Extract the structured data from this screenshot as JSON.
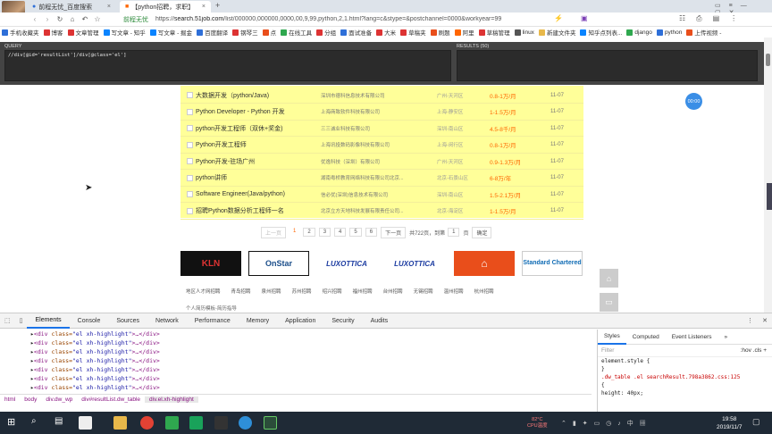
{
  "browser": {
    "tabs": [
      {
        "label": "前程无忧_百度搜索",
        "active": false
      },
      {
        "label": "【python招聘，求职】",
        "active": true
      }
    ],
    "new_tab_label": "+",
    "site_name": "前程无忧",
    "url_prefix": "https://",
    "url_domain": "search.51job.com",
    "url_rest": "/list/000000,000000,0000,00,9,99,python,2,1.html?lang=c&stype=&postchannel=0000&workyear=99",
    "bookmarks": [
      "手机收藏夹",
      "博客",
      "文章管理",
      "写文章 - 知乎",
      "写文章 - 掘金",
      "百度翻译",
      "钢琴三",
      "点",
      "在线工具",
      "分组",
      "面试准备",
      "大米",
      "草稿夹",
      "刷题",
      "阿里",
      "草稿管理",
      "linux",
      "新建文件夹",
      "知乎点列表...",
      "django",
      "python",
      "上传视频 -"
    ]
  },
  "xpath_helper": {
    "query_label": "QUERY",
    "results_label": "RESULTS (50)",
    "query": "//div[@id='resultList']/div[@class='el']"
  },
  "jobs": [
    {
      "title": "大数据开发（python/Java)",
      "company": "深圳市德科信息技术有限公司",
      "place": "广州-天河区",
      "salary": "0.8-1万/月",
      "date": "11-07"
    },
    {
      "title": "Python Developer - Python 开发",
      "company": "上海商致软件科技有限公司",
      "place": "上海-静安区",
      "salary": "1-1.5万/月",
      "date": "11-07"
    },
    {
      "title": "python开发工程师（双休+奖金)",
      "company": "三三诚业科技有限公司",
      "place": "深圳-南山区",
      "salary": "4.5-8千/月",
      "date": "11-07"
    },
    {
      "title": "Python开发工程师",
      "company": "上海讯投数码影像科技有限公司",
      "place": "上海-闵行区",
      "salary": "0.8-1万/月",
      "date": "11-07"
    },
    {
      "title": "Python开发-驻场广州",
      "company": "优逸科技（深圳）有限公司",
      "place": "广州-天河区",
      "salary": "0.9-1.3万/月",
      "date": "11-07"
    },
    {
      "title": "python讲师",
      "company": "湖南粤桥教育网络科技有限公司北京...",
      "place": "北京-石景山区",
      "salary": "6-8万/年",
      "date": "11-07"
    },
    {
      "title": "Software Engineer(Java/python)",
      "company": "信必优(深圳)信息技术有限公司",
      "place": "深圳-南山区",
      "salary": "1.5-2.1万/月",
      "date": "11-07"
    },
    {
      "title": "招聘Python数据分析工程师一名",
      "company": "北京立方天地科技发展有限责任公司...",
      "place": "北京-海淀区",
      "salary": "1-1.5万/月",
      "date": "11-07"
    }
  ],
  "pagination": {
    "prev": "上一页",
    "pages": [
      "1",
      "2",
      "3",
      "4",
      "5",
      "6"
    ],
    "next": "下一页",
    "total": "共722页，到第",
    "page_input": "1",
    "page_unit": "页",
    "confirm": "确定"
  },
  "logos": [
    "KLN",
    "OnStar",
    "LUXOTTICA",
    "LUXOTTICA",
    "",
    "Standard Chartered"
  ],
  "logo_colors": {
    "kln": "#8b1a1a",
    "onstar": "#1b4e8a",
    "luxottica": "#1a3aa0",
    "red_logo": "#e94e1b",
    "standard": "#0f6bb4"
  },
  "cities": [
    "地区人才网招聘",
    "青岛招聘",
    "泉州招聘",
    "苏州招聘",
    "绍兴招聘",
    "福州招聘",
    "台州招聘",
    "无锡招聘",
    "温州招聘",
    "杭州招聘"
  ],
  "resume_tip": "个人简历模板-简历指导",
  "timer": "00:00",
  "devtools": {
    "tabs": [
      "Elements",
      "Console",
      "Sources",
      "Network",
      "Performance",
      "Memory",
      "Application",
      "Security",
      "Audits"
    ],
    "active_tab": "Elements",
    "dom_lines": [
      {
        "tag_open": "<div ",
        "attr": "class=",
        "val": "\"el xh-highlight\"",
        "rest": ">…</div>"
      },
      {
        "tag_open": "<div ",
        "attr": "class=",
        "val": "\"el xh-highlight\"",
        "rest": ">…</div>"
      },
      {
        "tag_open": "<div ",
        "attr": "class=",
        "val": "\"el xh-highlight\"",
        "rest": ">…</div>"
      },
      {
        "tag_open": "<div ",
        "attr": "class=",
        "val": "\"el xh-highlight\"",
        "rest": ">…</div>"
      },
      {
        "tag_open": "<div ",
        "attr": "class=",
        "val": "\"el xh-highlight\"",
        "rest": ">…</div>"
      },
      {
        "tag_open": "<div ",
        "attr": "class=",
        "val": "\"el xh-highlight\"",
        "rest": ">…</div>"
      },
      {
        "tag_open": "<div ",
        "attr": "class=",
        "val": "\"el xh-highlight\"",
        "rest": ">…</div>"
      }
    ],
    "breadcrumbs": [
      "html",
      "body",
      "div.dw_wp",
      "div#resultList.dw_table",
      "div.el.xh-highlight"
    ],
    "styles_tabs": [
      "Styles",
      "Computed",
      "Event Listeners",
      "»"
    ],
    "filter_placeholder": "Filter",
    "hov_cls": ":hov  .cls  +",
    "css_lines": [
      "element.style {",
      "}",
      ".dw_table .el  searchResult.798a3862.css:125",
      "{",
      "  height: 40px;"
    ]
  },
  "taskbar": {
    "temp": "82°C",
    "temp_label": "CPU温度",
    "time": "19:58",
    "date": "2019/11/7"
  }
}
